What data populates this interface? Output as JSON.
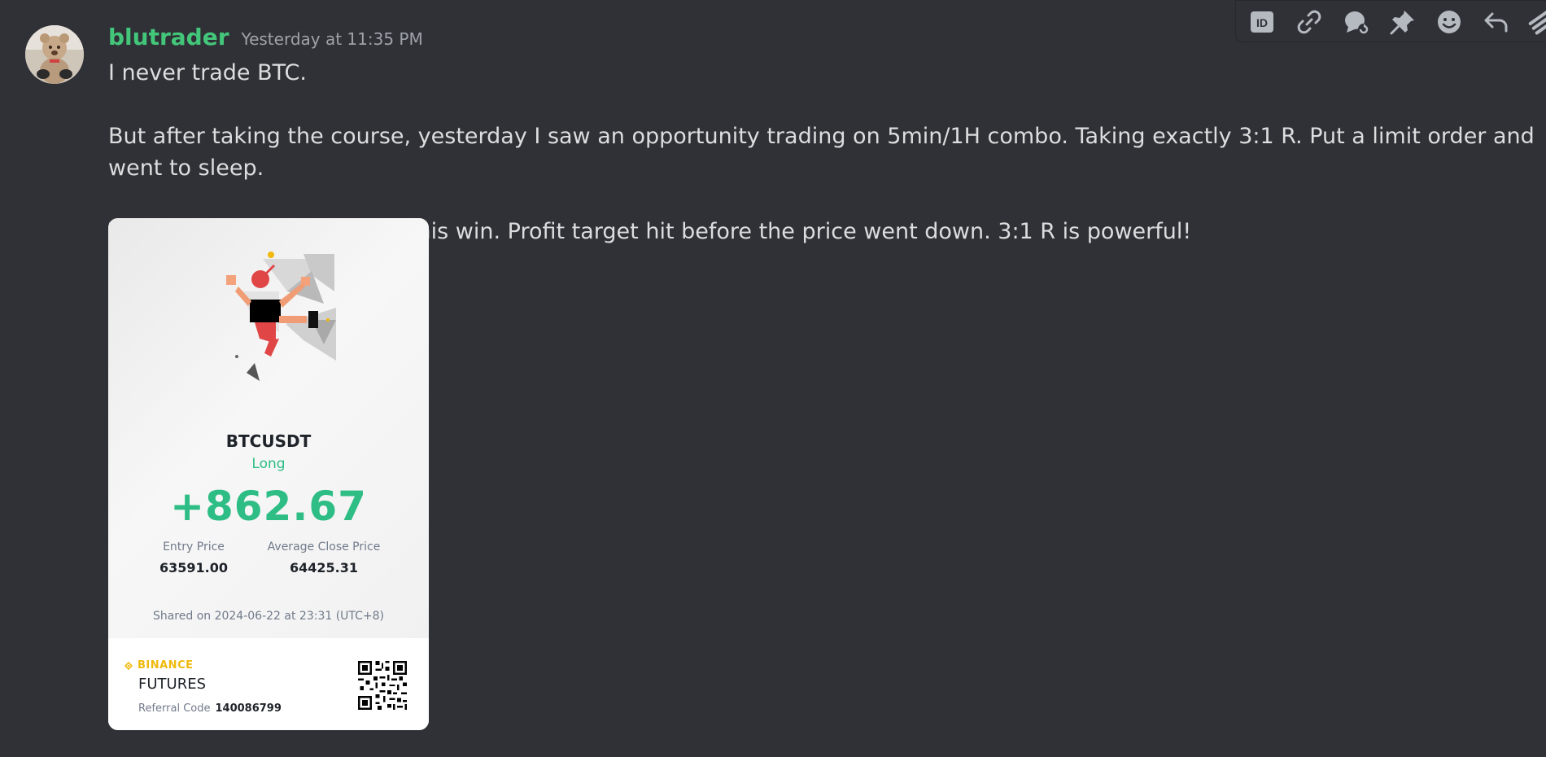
{
  "message": {
    "username": "blutrader",
    "timestamp": "Yesterday at 11:35 PM",
    "lines": [
      "I never trade BTC.",
      "But after taking the course, yesterday I saw an opportunity trading on 5min/1H combo. Taking exactly 3:1 R. Put a limit order and went to sleep.",
      "Woke up this morning with this win. Profit target hit before the price went down. 3:1 R is powerful!"
    ],
    "username_color": "#43c67a"
  },
  "toolbar": {
    "icons": [
      "id-icon",
      "link-icon",
      "thread-icon",
      "pin-icon",
      "emoji-icon",
      "reply-icon",
      "more-icon"
    ]
  },
  "card": {
    "pair": "BTCUSDT",
    "side": "Long",
    "pnl": "+862.67",
    "entry_label": "Entry Price",
    "entry_value": "63591.00",
    "close_label": "Average Close Price",
    "close_value": "64425.31",
    "shared": "Shared on 2024-06-22 at 23:31 (UTC+8)",
    "brand": "BINANCE",
    "product": "FUTURES",
    "referral_label": "Referral Code",
    "referral_code": "140086799",
    "accent_green": "#2ebd85",
    "brand_yellow": "#f0b90b"
  }
}
